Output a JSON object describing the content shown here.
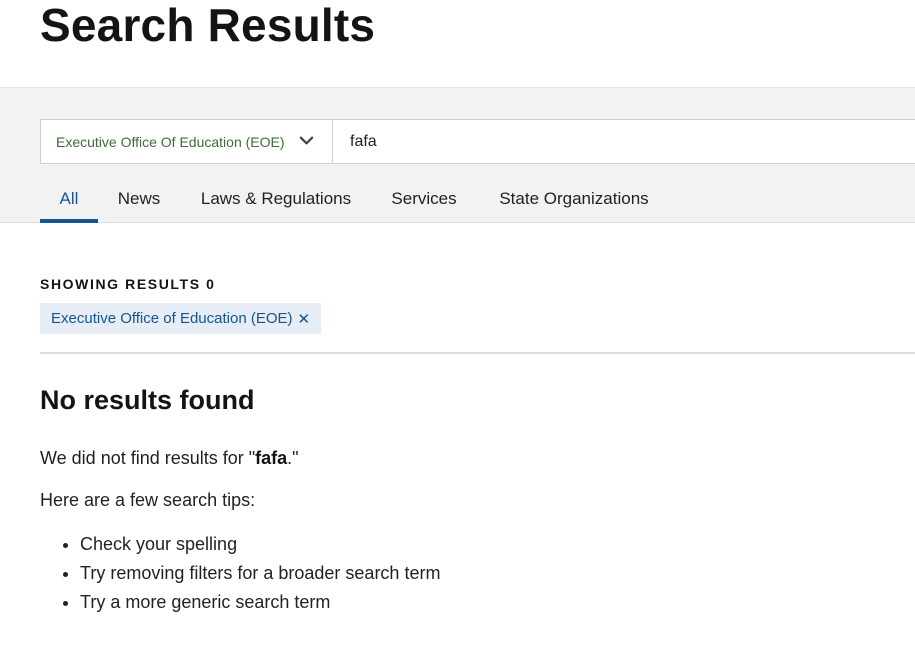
{
  "page": {
    "title": "Search Results"
  },
  "search": {
    "org_filter_label": "Executive Office Of Education (EOE)",
    "query": "fafa"
  },
  "tabs": [
    {
      "label": "All",
      "active": true
    },
    {
      "label": "News",
      "active": false
    },
    {
      "label": "Laws & Regulations",
      "active": false
    },
    {
      "label": "Services",
      "active": false
    },
    {
      "label": "State Organizations",
      "active": false
    }
  ],
  "results": {
    "count_label": "SHOWING RESULTS 0",
    "active_filter": "Executive Office of Education (EOE)",
    "active_filter_close_icon": "close-icon",
    "no_results_heading": "No results found",
    "not_found_prefix": "We did not find results for \"",
    "not_found_term": "fafa",
    "not_found_suffix": ".\"",
    "tips_intro": "Here are a few search tips:",
    "tips": [
      "Check your spelling",
      "Try removing filters for a broader search term",
      "Try a more generic search term"
    ]
  },
  "colors": {
    "accent_blue": "#14558f",
    "org_green": "#3f6b3a",
    "band_gray": "#f2f2f2",
    "chip_bg": "#e6edf5"
  }
}
